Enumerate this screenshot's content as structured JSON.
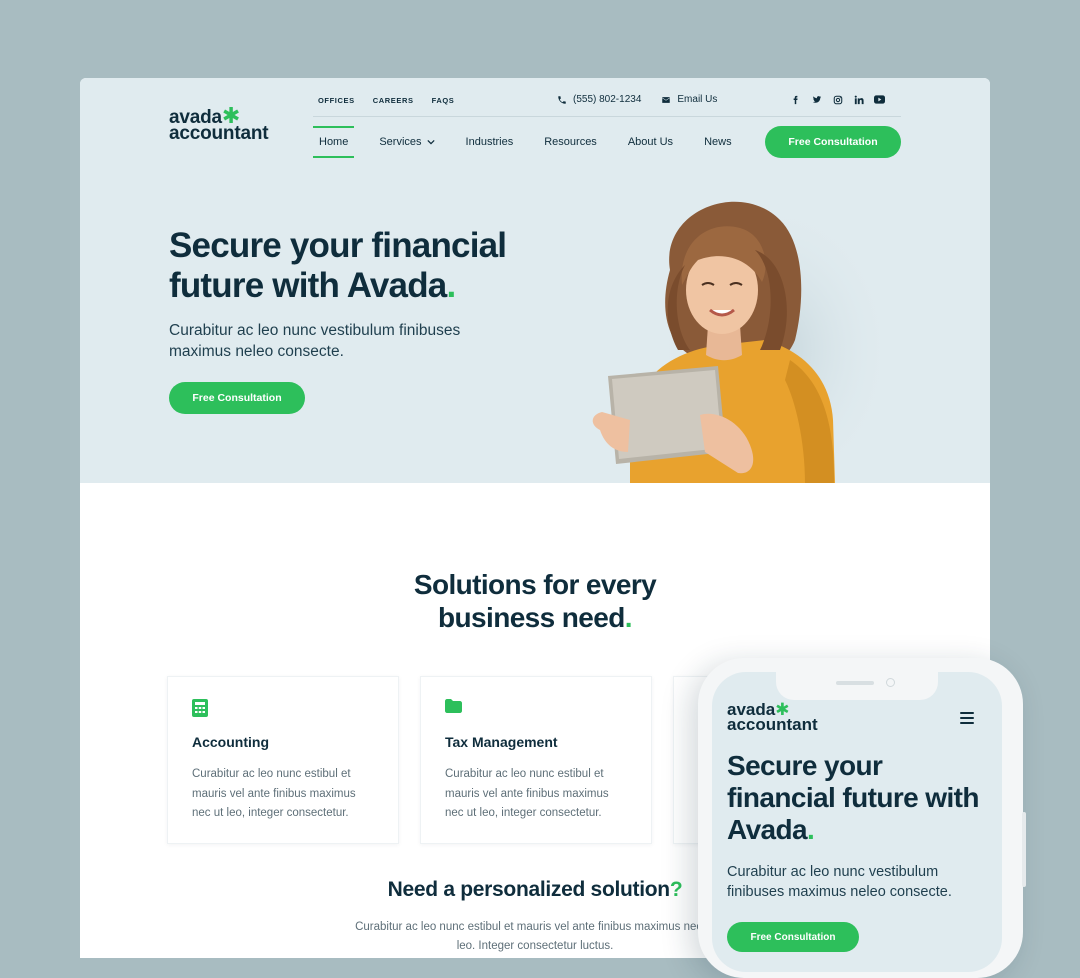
{
  "brand": {
    "line1": "avada",
    "line2": "accountant",
    "accent": "#2dbf5b",
    "dark": "#0f2d3c"
  },
  "util_nav": [
    "OFFICES",
    "CAREERS",
    "FAQS"
  ],
  "contact": {
    "phone": "(555) 802-1234",
    "email": "Email Us"
  },
  "socials": [
    "facebook-icon",
    "twitter-icon",
    "instagram-icon",
    "linkedin-icon",
    "youtube-icon"
  ],
  "nav": {
    "items": [
      "Home",
      "Services",
      "Industries",
      "Resources",
      "About Us",
      "News"
    ],
    "active": "Home",
    "cta": "Free Consultation"
  },
  "hero": {
    "title": "Secure your financial future with Avada",
    "title_dot": ".",
    "subtitle": "Curabitur ac leo nunc vestibulum finibuses maximus neleo consecte.",
    "cta": "Free Consultation"
  },
  "solutions": {
    "title_line1": "Solutions for every",
    "title_line2": "business need",
    "title_dot": ".",
    "cards": [
      {
        "icon": "calculator-icon",
        "title": "Accounting",
        "text": "Curabitur ac leo nunc estibul et mauris vel ante finibus maximus nec ut leo, integer consectetur."
      },
      {
        "icon": "folder-icon",
        "title": "Tax Management",
        "text": "Curabitur ac leo nunc estibul et mauris vel ante finibus maximus nec ut leo, integer consectetur."
      }
    ]
  },
  "need": {
    "title": "Need a personalized solution",
    "title_mark": "?",
    "text": "Curabitur ac leo nunc estibul et mauris vel ante finibus maximus nec ut leo. Integer consectetur luctus."
  },
  "mobile": {
    "logo_line1": "avada",
    "logo_line2": "accountant",
    "title": "Secure your financial future with Avada",
    "title_dot": ".",
    "subtitle": "Curabitur ac leo nunc vestibulum finibuses maximus neleo consecte.",
    "cta": "Free Consultation"
  }
}
